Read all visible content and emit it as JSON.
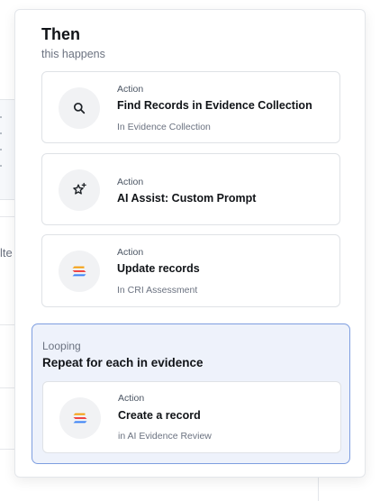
{
  "panel": {
    "title": "Then",
    "subtitle": "this happens"
  },
  "steps": [
    {
      "kind": "Action",
      "title": "Find Records in Evidence Collection",
      "subtitle": "In Evidence Collection",
      "icon": "search-icon"
    },
    {
      "kind": "Action",
      "title": "AI Assist: Custom Prompt",
      "subtitle": "",
      "icon": "sparkle-star-icon"
    },
    {
      "kind": "Action",
      "title": "Update records",
      "subtitle": "In CRI Assessment",
      "icon": "stacked-layers-logo-icon"
    }
  ],
  "loop": {
    "label": "Looping",
    "title": "Repeat for each in evidence",
    "step": {
      "kind": "Action",
      "title": "Create a record",
      "subtitle": "in AI Evidence Review",
      "icon": "stacked-layers-logo-icon"
    }
  },
  "background": {
    "partial_text": "lte"
  },
  "colors": {
    "loop_bg": "#eef2fb",
    "loop_border": "#7e9ee0",
    "logo_orange": "#f59e0b",
    "logo_red": "#ef4444",
    "logo_blue": "#3b82f6"
  }
}
